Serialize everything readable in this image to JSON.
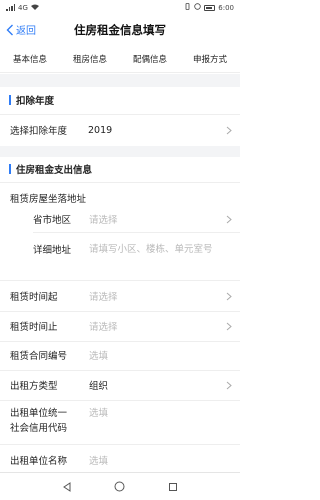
{
  "status_bar": {
    "time": "6:00",
    "signal": "4G",
    "battery": ""
  },
  "nav": {
    "back_label": "返回",
    "title": "住房租金信息填写"
  },
  "tabs": [
    "基本信息",
    "租房信息",
    "配偶信息",
    "申报方式"
  ],
  "deduct_section": {
    "title": "扣除年度",
    "row_label": "选择扣除年度",
    "row_value": "2019"
  },
  "rent_section": {
    "title": "住房租金支出信息",
    "address_label": "租赁房屋坐落地址",
    "province_label": "省市地区",
    "province_placeholder": "请选择",
    "detail_label": "详细地址",
    "detail_placeholder": "请填写小区、楼栋、单元室号",
    "start_label": "租赁时间起",
    "start_placeholder": "请选择",
    "end_label": "租赁时间止",
    "end_placeholder": "请选择",
    "contract_label": "租赁合同编号",
    "contract_placeholder": "选填",
    "lessor_type_label": "出租方类型",
    "lessor_type_value": "组织",
    "credit_code_label_1": "出租单位统一",
    "credit_code_label_2": "社会信用代码",
    "credit_code_placeholder": "选填",
    "lessor_name_label": "出租单位名称",
    "lessor_name_placeholder": "选填"
  },
  "colors": {
    "accent": "#2f7cf6",
    "placeholder": "#b9b9b9",
    "section_bg": "#f3f4f6"
  }
}
